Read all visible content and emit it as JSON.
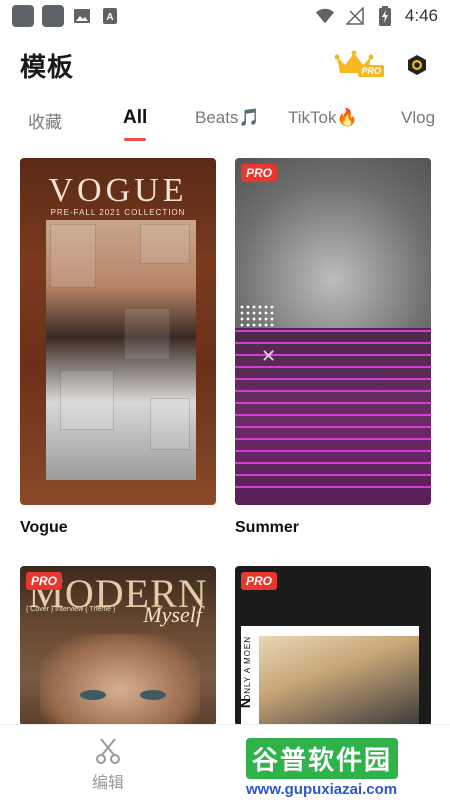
{
  "status_bar": {
    "time": "4:46",
    "icons": [
      "app-icon",
      "app-icon",
      "image-icon",
      "font-icon",
      "wifi-icon",
      "no-signal-icon",
      "battery-charging-icon"
    ]
  },
  "header": {
    "title": "模板",
    "pro_label": "PRO",
    "icons": [
      "crown-icon",
      "settings-icon"
    ]
  },
  "tabs": [
    {
      "label": "收藏"
    },
    {
      "label": "All",
      "active": true
    },
    {
      "label": "Beats🎵"
    },
    {
      "label": "TikTok🔥"
    },
    {
      "label": "Vlog"
    }
  ],
  "templates": [
    {
      "name": "Vogue",
      "pro": false,
      "thumb_text": "VOGUE",
      "thumb_sub": "PRE-FALL 2021 COLLECTION"
    },
    {
      "name": "Summer",
      "pro": true,
      "pro_label": "PRO"
    },
    {
      "name": "",
      "pro": true,
      "pro_label": "PRO",
      "thumb_text": "MODERN",
      "thumb_script": "Myself",
      "thumb_meta": "{ Cover }  Interview  { Theme }"
    },
    {
      "name": "",
      "pro": true,
      "pro_label": "PRO",
      "thumb_vertical": "ONLY A MOEN",
      "thumb_letter": "N"
    }
  ],
  "bottom_nav": {
    "items": [
      {
        "label": "编辑",
        "icon": "scissors-icon"
      }
    ]
  },
  "watermark": {
    "title": "谷普软件园",
    "url": "www.gupuxiazai.com"
  },
  "colors": {
    "accent": "#f24b4b",
    "pro_badge": "#e8372f",
    "pro_gold": "#f5b922",
    "summer_lines": "#e040e0"
  }
}
